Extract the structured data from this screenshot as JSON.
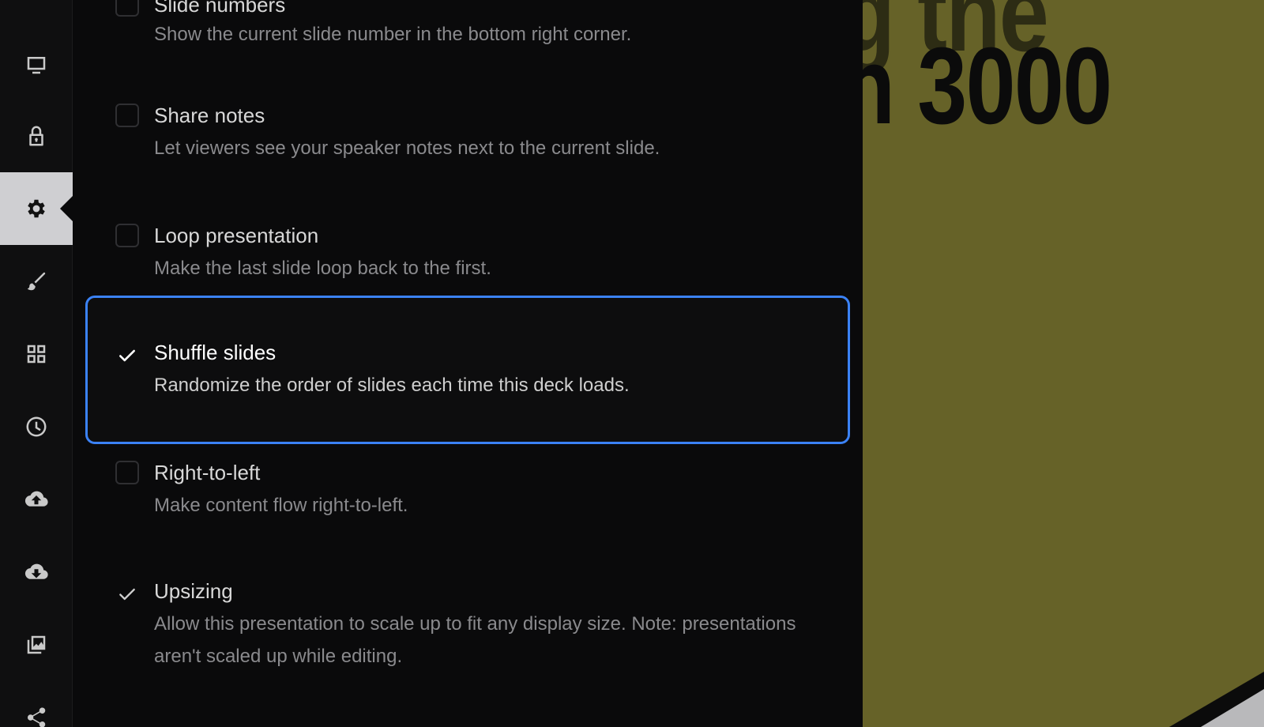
{
  "rail": {
    "items": [
      {
        "name": "present-icon"
      },
      {
        "name": "lock-icon"
      },
      {
        "name": "settings-icon",
        "active": true
      },
      {
        "name": "brush-icon"
      },
      {
        "name": "grid-icon"
      },
      {
        "name": "history-icon"
      },
      {
        "name": "cloud-upload-icon"
      },
      {
        "name": "cloud-download-icon"
      },
      {
        "name": "image-library-icon"
      },
      {
        "name": "share-icon"
      }
    ]
  },
  "settings": {
    "options": [
      {
        "key": "slide-numbers",
        "title": "Slide numbers",
        "description": "Show the current slide number in the bottom right corner.",
        "checked": false
      },
      {
        "key": "share-notes",
        "title": "Share notes",
        "description": "Let viewers see your speaker notes next to the current slide.",
        "checked": false
      },
      {
        "key": "loop-presentation",
        "title": "Loop presentation",
        "description": "Make the last slide loop back to the first.",
        "checked": false
      },
      {
        "key": "shuffle-slides",
        "title": "Shuffle slides",
        "description": "Randomize the order of slides each time this deck loads.",
        "checked": true,
        "focused": true
      },
      {
        "key": "right-to-left",
        "title": "Right-to-left",
        "description": "Make content flow right-to-left.",
        "checked": false
      },
      {
        "key": "upsizing",
        "title": "Upsizing",
        "description": "Allow this presentation to scale up to fit any display size. Note: presentations aren't scaled up while editing.",
        "checked": true
      }
    ]
  },
  "preview": {
    "line1": "g the",
    "line2": "n 3000",
    "background": "#666228",
    "accent": "#3b82f6"
  }
}
